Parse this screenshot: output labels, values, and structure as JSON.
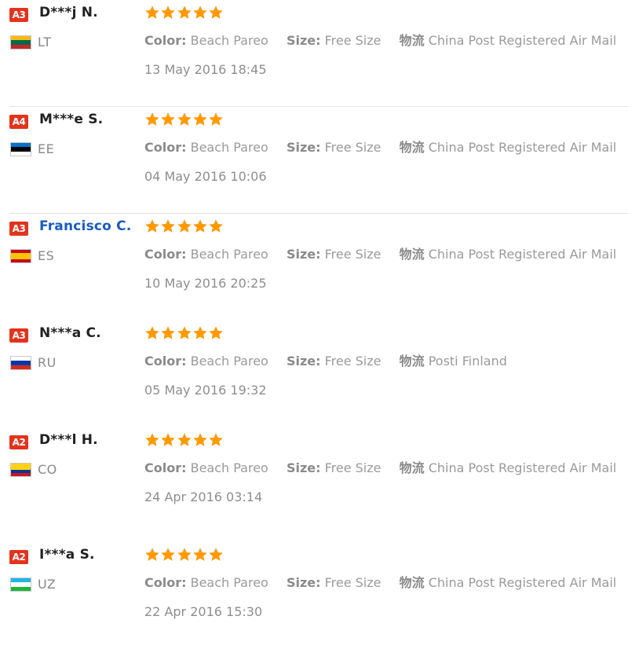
{
  "colors": {
    "badge": "#e4331d",
    "star": "#ff9900",
    "link": "#1a5bc4",
    "divider": "#e3e3e3"
  },
  "labels": {
    "color_key": "Color:",
    "size_key": "Size:",
    "shipping_key": "物流"
  },
  "reviews": [
    {
      "badge": "A3",
      "name": "D***j N.",
      "name_is_link": false,
      "country": "LT",
      "flag": "lithuania-flag-icon",
      "rating": 5,
      "color": "Beach Pareo",
      "size": "Free Size",
      "shipping": "China Post Registered Air Mail",
      "date": "13 May 2016 18:45"
    },
    {
      "badge": "A4",
      "name": "M***e S.",
      "name_is_link": false,
      "country": "EE",
      "flag": "estonia-flag-icon",
      "rating": 5,
      "color": "Beach Pareo",
      "size": "Free Size",
      "shipping": "China Post Registered Air Mail",
      "date": "04 May 2016 10:06"
    },
    {
      "badge": "A3",
      "name": "Francisco C.",
      "name_is_link": true,
      "country": "ES",
      "flag": "spain-flag-icon",
      "rating": 5,
      "color": "Beach Pareo",
      "size": "Free Size",
      "shipping": "China Post Registered Air Mail",
      "date": "10 May 2016 20:25"
    },
    {
      "badge": "A3",
      "name": "N***a C.",
      "name_is_link": false,
      "country": "RU",
      "flag": "russia-flag-icon",
      "rating": 5,
      "color": "Beach Pareo",
      "size": "Free Size",
      "shipping": "Posti Finland",
      "date": "05 May 2016 19:32"
    },
    {
      "badge": "A2",
      "name": "D***l H.",
      "name_is_link": false,
      "country": "CO",
      "flag": "colombia-flag-icon",
      "rating": 5,
      "color": "Beach Pareo",
      "size": "Free Size",
      "shipping": "China Post Registered Air Mail",
      "date": "24 Apr 2016 03:14"
    },
    {
      "badge": "A2",
      "name": "I***a S.",
      "name_is_link": false,
      "country": "UZ",
      "flag": "uzbekistan-flag-icon",
      "rating": 5,
      "color": "Beach Pareo",
      "size": "Free Size",
      "shipping": "China Post Registered Air Mail",
      "date": "22 Apr 2016 15:30"
    }
  ]
}
